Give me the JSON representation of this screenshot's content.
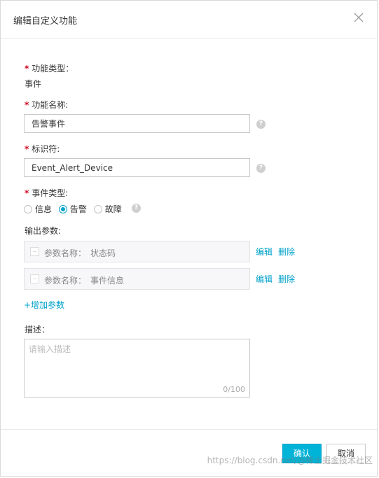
{
  "dialog": {
    "title": "编辑自定义功能"
  },
  "form": {
    "function_type": {
      "label": "功能类型：",
      "value": "事件"
    },
    "function_name": {
      "label": "功能名称:",
      "value": "告警事件"
    },
    "identifier": {
      "label": "标识符:",
      "value": "Event_Alert_Device"
    },
    "event_type": {
      "label": "事件类型:",
      "options": [
        {
          "label": "信息",
          "checked": false
        },
        {
          "label": "告警",
          "checked": true
        },
        {
          "label": "故障",
          "checked": false
        }
      ]
    },
    "output_params": {
      "label": "输出参数:",
      "rows": [
        {
          "prefix": "参数名称：",
          "name": "状态码",
          "edit": "编辑",
          "delete": "删除"
        },
        {
          "prefix": "参数名称：",
          "name": "事件信息",
          "edit": "编辑",
          "delete": "删除"
        }
      ],
      "add_label": "+增加参数"
    },
    "description": {
      "label": "描述：",
      "placeholder": "请输入描述",
      "value": "",
      "counter": "0/100"
    },
    "help_icon": "?"
  },
  "footer": {
    "confirm_label": "确认",
    "cancel_label": "取消"
  },
  "watermark": "https://blog.csdn.net/@稀土掘金技术社区",
  "colors": {
    "accent": "#00b4d8",
    "link": "#00a2ca",
    "required": "#d0021b"
  },
  "icons": {
    "close": "close-icon",
    "help": "help-icon"
  }
}
